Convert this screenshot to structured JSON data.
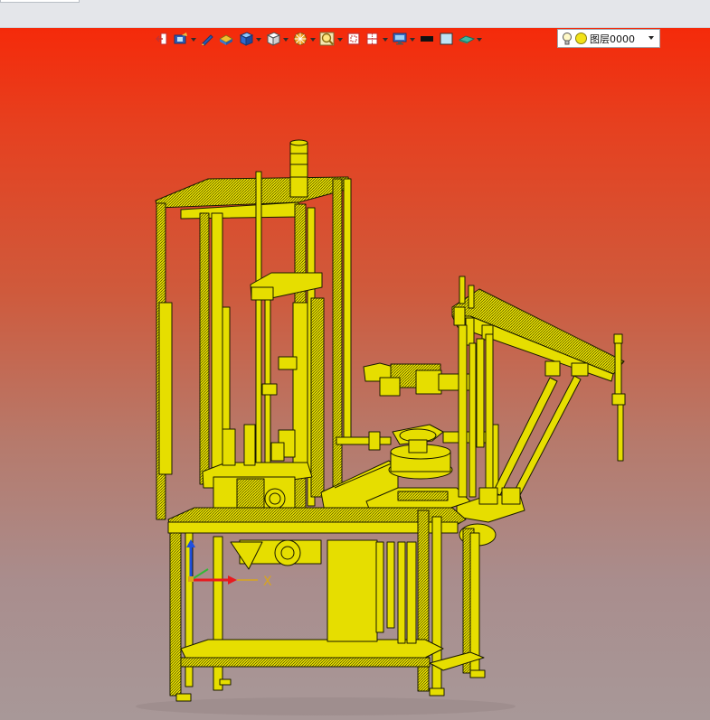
{
  "toolbar": {
    "icons": [
      {
        "name": "door-exit-icon",
        "has_dropdown": false
      },
      {
        "name": "camera-view-icon",
        "has_dropdown": true
      },
      {
        "name": "pencil-icon",
        "has_dropdown": false
      },
      {
        "name": "shaded-solid-icon",
        "has_dropdown": false
      },
      {
        "name": "blue-cube-icon",
        "has_dropdown": true
      },
      {
        "name": "white-cube-icon",
        "has_dropdown": true
      },
      {
        "name": "section-wheel-icon",
        "has_dropdown": true
      },
      {
        "name": "zoom-lens-icon",
        "has_dropdown": true
      },
      {
        "name": "view-square-icon",
        "has_dropdown": false
      },
      {
        "name": "clip-plane-icon",
        "has_dropdown": true
      },
      {
        "name": "display-monitor-icon",
        "has_dropdown": true
      },
      {
        "name": "line-color-icon",
        "has_dropdown": false
      },
      {
        "name": "fill-color-icon",
        "has_dropdown": false
      },
      {
        "name": "layer-plane-icon",
        "has_dropdown": true
      }
    ],
    "colors": {
      "line_color": "#111111",
      "fill_color": "#bfe3f5"
    }
  },
  "layer_select": {
    "value": "图层0000",
    "icons": [
      "lightbulb-icon",
      "layer-color-dot-icon",
      "dropdown-arrow-icon"
    ]
  },
  "viewport": {
    "background_top": "#f52a0a",
    "background_bottom": "#a89898",
    "model_color": "#e8e000",
    "edge_color": "#1a1a00"
  },
  "triad": {
    "x_label": "X",
    "x_color": "#e8191e",
    "y_color": "#32b834",
    "z_color": "#1f4fe0",
    "origin_label_color": "#d9a51c"
  }
}
